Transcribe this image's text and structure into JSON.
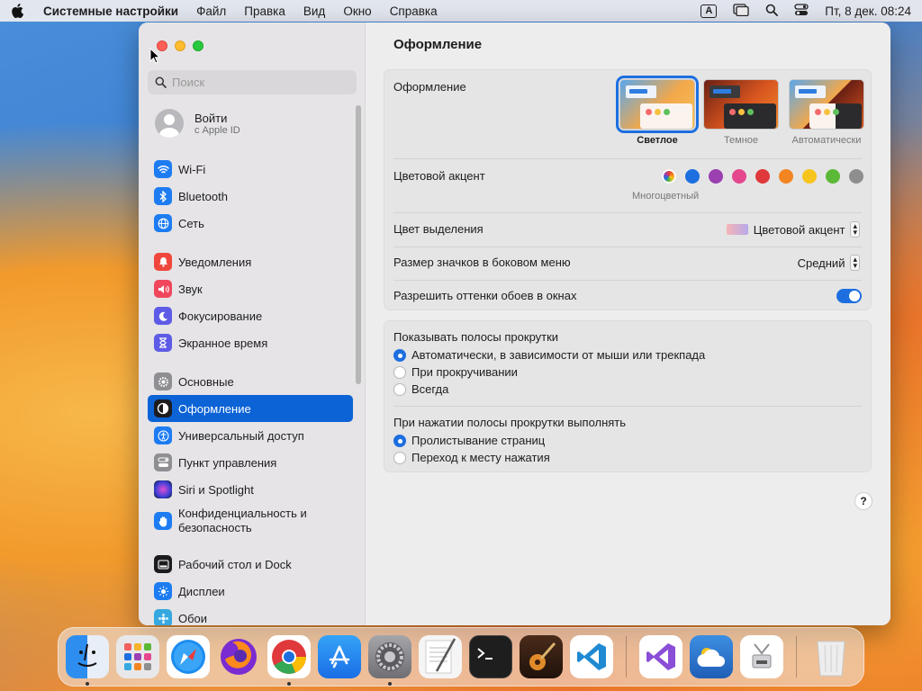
{
  "menubar": {
    "app_name": "Системные настройки",
    "menus": [
      "Файл",
      "Правка",
      "Вид",
      "Окно",
      "Справка"
    ],
    "input_indicator": "A",
    "datetime": "Пт, 8 дек.  08:24"
  },
  "sidebar": {
    "search_placeholder": "Поиск",
    "account": {
      "name": "Войти",
      "sub": "с Apple ID"
    },
    "items": [
      {
        "label": "Wi-Fi",
        "icon": "wifi-icon",
        "color": "#1d7cf2"
      },
      {
        "label": "Bluetooth",
        "icon": "bluetooth-icon",
        "color": "#1d7cf2"
      },
      {
        "label": "Сеть",
        "icon": "globe-icon",
        "color": "#1d7cf2"
      },
      {
        "label": "Уведомления",
        "icon": "bell-icon",
        "color": "#f0473c"
      },
      {
        "label": "Звук",
        "icon": "speaker-icon",
        "color": "#f0475d"
      },
      {
        "label": "Фокусирование",
        "icon": "moon-icon",
        "color": "#5e5ce6"
      },
      {
        "label": "Экранное время",
        "icon": "hourglass-icon",
        "color": "#5e5ce6"
      },
      {
        "label": "Основные",
        "icon": "gear-icon",
        "color": "#8e8e93"
      },
      {
        "label": "Оформление",
        "icon": "appearance-icon",
        "color": "#1c1c1e"
      },
      {
        "label": "Универсальный доступ",
        "icon": "accessibility-icon",
        "color": "#1d7cf2"
      },
      {
        "label": "Пункт управления",
        "icon": "control-center-icon",
        "color": "#8e8e93"
      },
      {
        "label": "Siri и Spotlight",
        "icon": "siri-icon",
        "color": "#9b4fd6"
      },
      {
        "label": "Конфиденциальность и безопасность",
        "icon": "hand-icon",
        "color": "#1d7cf2"
      },
      {
        "label": "Рабочий стол и Dock",
        "icon": "dock-icon",
        "color": "#1c1c1e"
      },
      {
        "label": "Дисплеи",
        "icon": "sun-icon",
        "color": "#1d7cf2"
      },
      {
        "label": "Обои",
        "icon": "wallpaper-icon",
        "color": "#36a8e0"
      }
    ]
  },
  "main": {
    "title": "Оформление",
    "appearance_label": "Оформление",
    "themes": [
      {
        "label": "Светлое",
        "selected": true
      },
      {
        "label": "Темное",
        "selected": false
      },
      {
        "label": "Автоматически",
        "selected": false
      }
    ],
    "accent_label": "Цветовой акцент",
    "accent_colors": [
      "multicolor",
      "#1d6fe0",
      "#9b3fb1",
      "#e5478f",
      "#e0393b",
      "#f28522",
      "#f7c41d",
      "#5cb937",
      "#8e8e8e"
    ],
    "accent_selected_name": "Многоцветный",
    "highlight_label": "Цвет выделения",
    "highlight_value": "Цветовой акцент",
    "icon_size_label": "Размер значков в боковом меню",
    "icon_size_value": "Средний",
    "tint_label": "Разрешить оттенки обоев в окнах",
    "tint_on": true,
    "scroll_show_label": "Показывать полосы прокрутки",
    "scroll_show_options": [
      "Автоматически, в зависимости от мыши или трекпада",
      "При прокручивании",
      "Всегда"
    ],
    "scroll_click_label": "При нажатии полосы прокрутки выполнять",
    "scroll_click_options": [
      "Пролистывание страниц",
      "Переход к месту нажатия"
    ],
    "help": "?"
  },
  "dock": {
    "apps": [
      {
        "name": "finder",
        "color": "#2e8ef0"
      },
      {
        "name": "launchpad",
        "color": "#e8e8ea"
      },
      {
        "name": "safari",
        "color": "#1c8cf0"
      },
      {
        "name": "firefox",
        "color": "#7a2bd1"
      },
      {
        "name": "chrome",
        "color": "#ffffff"
      },
      {
        "name": "app-store",
        "color": "#1e88f2"
      },
      {
        "name": "system-settings",
        "color": "#8e8e93"
      },
      {
        "name": "textedit",
        "color": "#f3f3f3"
      },
      {
        "name": "terminal",
        "color": "#1e1e1e"
      },
      {
        "name": "garageband",
        "color": "#3a2418"
      },
      {
        "name": "vscode",
        "color": "#ffffff"
      },
      {
        "name": "visual-studio",
        "color": "#ffffff"
      },
      {
        "name": "weather",
        "color": "#2f7fd6"
      },
      {
        "name": "disk-utility",
        "color": "#ffffff"
      },
      {
        "name": "trash",
        "color": "#e6e6e6"
      }
    ]
  }
}
